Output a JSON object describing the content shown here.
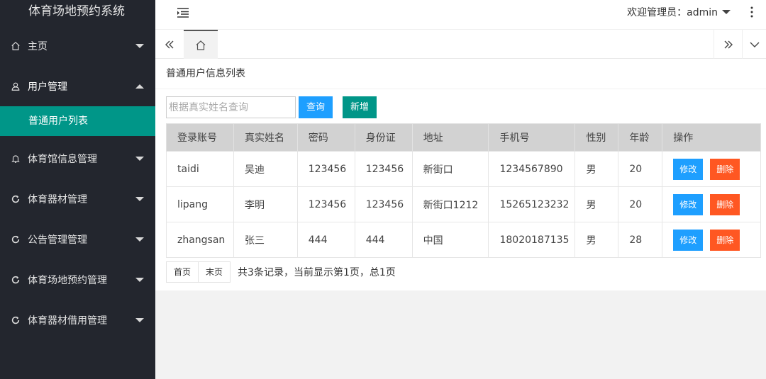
{
  "app": {
    "title": "体育场地预约系统"
  },
  "header": {
    "welcome": "欢迎管理员：admin"
  },
  "sidebar": {
    "items": [
      {
        "label": "主页",
        "icon": "home-icon"
      },
      {
        "label": "用户管理",
        "icon": "user-icon",
        "expanded": true,
        "children": [
          {
            "label": "普通用户列表"
          }
        ]
      },
      {
        "label": "体育馆信息管理",
        "icon": "bell-icon"
      },
      {
        "label": "体育器材管理",
        "icon": "refresh-icon"
      },
      {
        "label": "公告管理管理",
        "icon": "refresh-icon"
      },
      {
        "label": "体育场地预约管理",
        "icon": "refresh-icon"
      },
      {
        "label": "体育器材借用管理",
        "icon": "refresh-icon"
      }
    ]
  },
  "page": {
    "title": "普通用户信息列表",
    "search_placeholder": "根据真实姓名查询",
    "query_label": "查询",
    "add_label": "新增"
  },
  "table": {
    "columns": [
      "登录账号",
      "真实姓名",
      "密码",
      "身份证",
      "地址",
      "手机号",
      "性别",
      "年龄",
      "操作"
    ],
    "rows": [
      [
        "taidi",
        "吴迪",
        "123456",
        "123456",
        "新街口",
        "1234567890",
        "男",
        "20"
      ],
      [
        "lipang",
        "李明",
        "123456",
        "123456",
        "新街口1212",
        "15265123232",
        "男",
        "20"
      ],
      [
        "zhangsan",
        "张三",
        "444",
        "444",
        "中国",
        "18020187135",
        "男",
        "28"
      ]
    ],
    "edit_label": "修改",
    "delete_label": "删除"
  },
  "pager": {
    "first_label": "首页",
    "last_label": "末页",
    "info": "共3条记录，当前显示第1页，总1页"
  },
  "colors": {
    "sidebar": "#23262e",
    "accent": "#009688",
    "primary": "#1e9fff",
    "danger": "#ff5722"
  }
}
